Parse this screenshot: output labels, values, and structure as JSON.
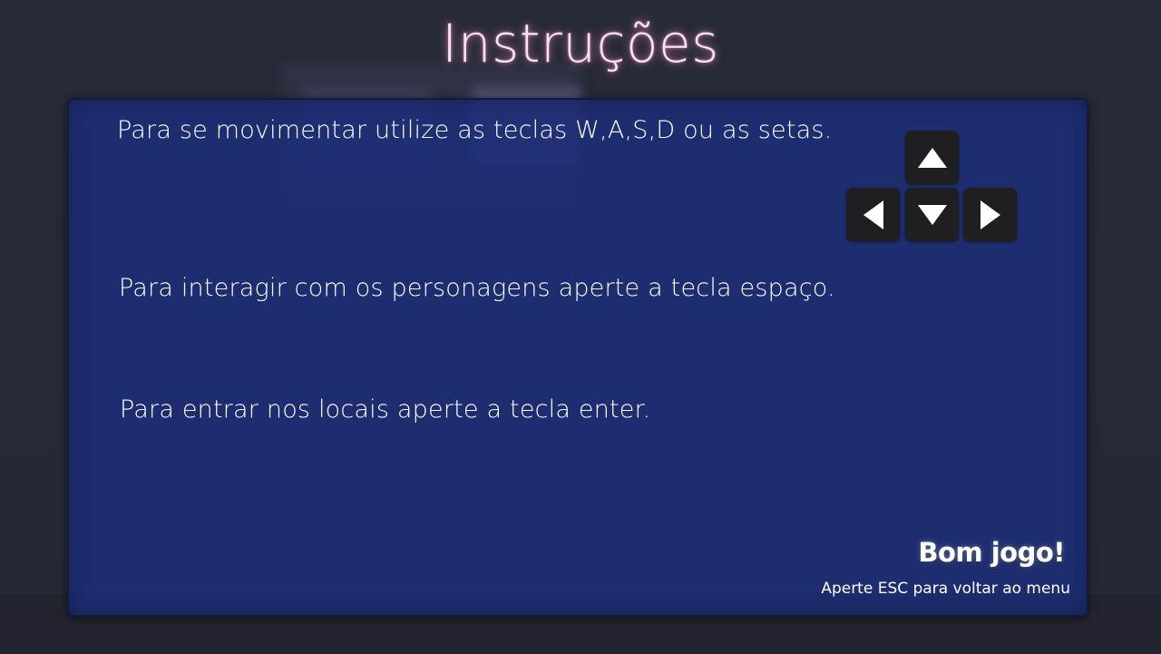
{
  "title": "Instruções",
  "instructions": {
    "movement": "Para se movimentar utilize as teclas W,A,S,D ou as setas.",
    "interact": "Para interagir com os personagens aperte a tecla espaço.",
    "enter": "Para entrar nos locais aperte a tecla enter."
  },
  "arrow_keys": [
    {
      "name": "up",
      "icon": "arrow-up-icon"
    },
    {
      "name": "left",
      "icon": "arrow-left-icon"
    },
    {
      "name": "down",
      "icon": "arrow-down-icon"
    },
    {
      "name": "right",
      "icon": "arrow-right-icon"
    }
  ],
  "footer": {
    "greeting": "Bom jogo!",
    "esc_hint": "Aperte ESC para voltar ao menu"
  },
  "colors": {
    "title_glow": "#e68cc8",
    "panel_bg": "#1c2d78",
    "key_bg": "#1f1f22",
    "text": "#ffffff",
    "background": "#262835"
  }
}
